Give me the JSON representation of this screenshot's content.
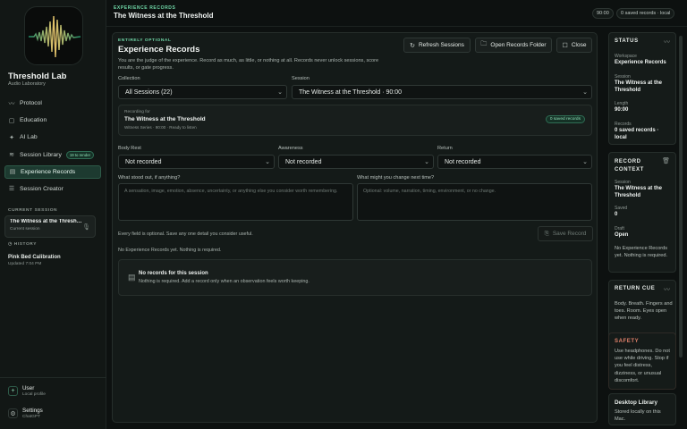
{
  "sidebar": {
    "app_name": "Threshold Lab",
    "app_subtitle": "Audio Laboratory",
    "nav": [
      {
        "label": "Protocol",
        "icon": "pulse-icon"
      },
      {
        "label": "Education",
        "icon": "book-icon"
      },
      {
        "label": "AI Lab",
        "icon": "sparkle-icon"
      },
      {
        "label": "Session Library",
        "icon": "waveform-icon",
        "badge": "19 to render"
      },
      {
        "label": "Experience Records",
        "icon": "note-icon",
        "active": true
      },
      {
        "label": "Session Creator",
        "icon": "sliders-icon"
      }
    ],
    "current_session_label": "CURRENT SESSION",
    "current_session_title": "The Witness at the Threshold",
    "current_session_sub": "Current session",
    "history_label": "HISTORY",
    "history_title": "Pink Bed Calibration",
    "history_sub": "Updated 7:04 PM",
    "user_title": "User",
    "user_sub": "Local profile",
    "settings_title": "Settings",
    "settings_sub": "ChatGPT"
  },
  "topbar": {
    "kicker": "EXPERIENCE RECORDS",
    "title": "The Witness at the Threshold",
    "pill_time": "90:00",
    "pill_records": "0 saved records · local"
  },
  "main": {
    "kicker": "ENTIRELY OPTIONAL",
    "title": "Experience Records",
    "description": "You are the judge of the experience. Record as much, as little, or nothing at all. Records never unlock sessions, score results, or gate progress.",
    "refresh_label": "Refresh Sessions",
    "open_folder_label": "Open Records Folder",
    "close_label": "Close",
    "collection_label": "Collection",
    "collection_value": "All Sessions (22)",
    "session_label": "Session",
    "session_value": "The Witness at the Threshold · 90:00",
    "recording_for_label": "Recording for",
    "recording_title": "The Witness at the Threshold",
    "recording_sub": "Witness Series · 90:00 · Ready to listen",
    "recording_badge": "0 saved records",
    "body_rest_label": "Body Rest",
    "body_rest_value": "Not recorded",
    "awareness_label": "Awareness",
    "awareness_value": "Not recorded",
    "return_label": "Return",
    "return_value": "Not recorded",
    "stood_out_label": "What stood out, if anything?",
    "stood_out_placeholder": "A sensation, image, emotion, absence, uncertainty, or anything else you consider worth remembering.",
    "change_label": "What might you change next time?",
    "change_placeholder": "Optional: volume, narration, timing, environment, or no change.",
    "optional_note": "Every field is optional. Save any one detail you consider useful.",
    "save_label": "Save Record",
    "no_records_note": "No Experience Records yet. Nothing is required.",
    "empty_title": "No records for this session",
    "empty_sub": "Nothing is required. Add a record only when an observation feels worth keeping."
  },
  "rail": {
    "status_title": "STATUS",
    "workspace_k": "Workspace",
    "workspace_v": "Experience Records",
    "session_k": "Session",
    "session_v": "The Witness at the Threshold",
    "length_k": "Length",
    "length_v": "90:00",
    "records_k": "Records",
    "records_v": "0 saved records · local",
    "context_title": "RECORD CONTEXT",
    "ctx_session_k": "Session",
    "ctx_session_v": "The Witness at the Threshold",
    "saved_k": "Saved",
    "saved_v": "0",
    "draft_k": "Draft",
    "draft_v": "Open",
    "ctx_note": "No Experience Records yet. Nothing is required.",
    "return_cue_title": "RETURN CUE",
    "return_cue_text": "Body. Breath. Fingers and toes. Room. Eyes open when ready.",
    "safety_title": "SAFETY",
    "safety_text": "Use headphones. Do not use while driving. Stop if you feel distress, dizziness, or unusual discomfort.",
    "library_title": "Desktop Library",
    "library_text": "Stored locally on this Mac."
  },
  "colors": {
    "accent": "#6fd6a6",
    "safety": "#e0806a",
    "background": "#0d1110"
  }
}
